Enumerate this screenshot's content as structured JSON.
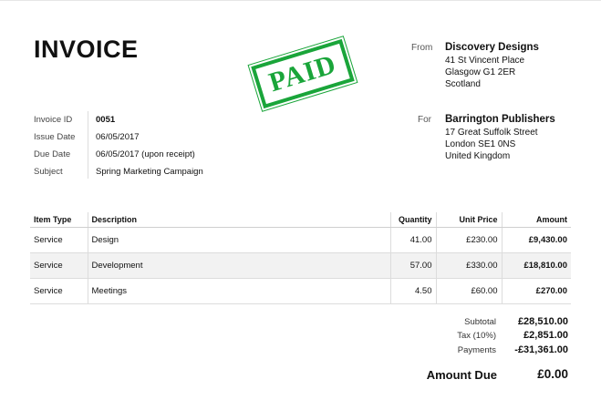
{
  "title": "INVOICE",
  "stamp": "PAID",
  "from": {
    "label": "From",
    "name": "Discovery Designs",
    "lines": [
      "41 St Vincent Place",
      "Glasgow G1 2ER",
      "Scotland"
    ]
  },
  "for": {
    "label": "For",
    "name": "Barrington Publishers",
    "lines": [
      "17 Great Suffolk Street",
      "London SE1 0NS",
      "United Kingdom"
    ]
  },
  "meta": [
    {
      "label": "Invoice ID",
      "value": "0051"
    },
    {
      "label": "Issue Date",
      "value": "06/05/2017"
    },
    {
      "label": "Due Date",
      "value": "06/05/2017 (upon receipt)"
    },
    {
      "label": "Subject",
      "value": "Spring Marketing Campaign"
    }
  ],
  "table": {
    "headers": [
      "Item Type",
      "Description",
      "Quantity",
      "Unit Price",
      "Amount"
    ],
    "rows": [
      [
        "Service",
        "Design",
        "41.00",
        "£230.00",
        "£9,430.00"
      ],
      [
        "Service",
        "Development",
        "57.00",
        "£330.00",
        "£18,810.00"
      ],
      [
        "Service",
        "Meetings",
        "4.50",
        "£60.00",
        "£270.00"
      ]
    ]
  },
  "totals": {
    "subtotal_label": "Subtotal",
    "subtotal": "£28,510.00",
    "tax_label": "Tax (10%)",
    "tax": "£2,851.00",
    "payments_label": "Payments",
    "payments": "-£31,361.00",
    "due_label": "Amount Due",
    "due": "£0.00"
  },
  "colors": {
    "stamp": "#1aa53a"
  }
}
